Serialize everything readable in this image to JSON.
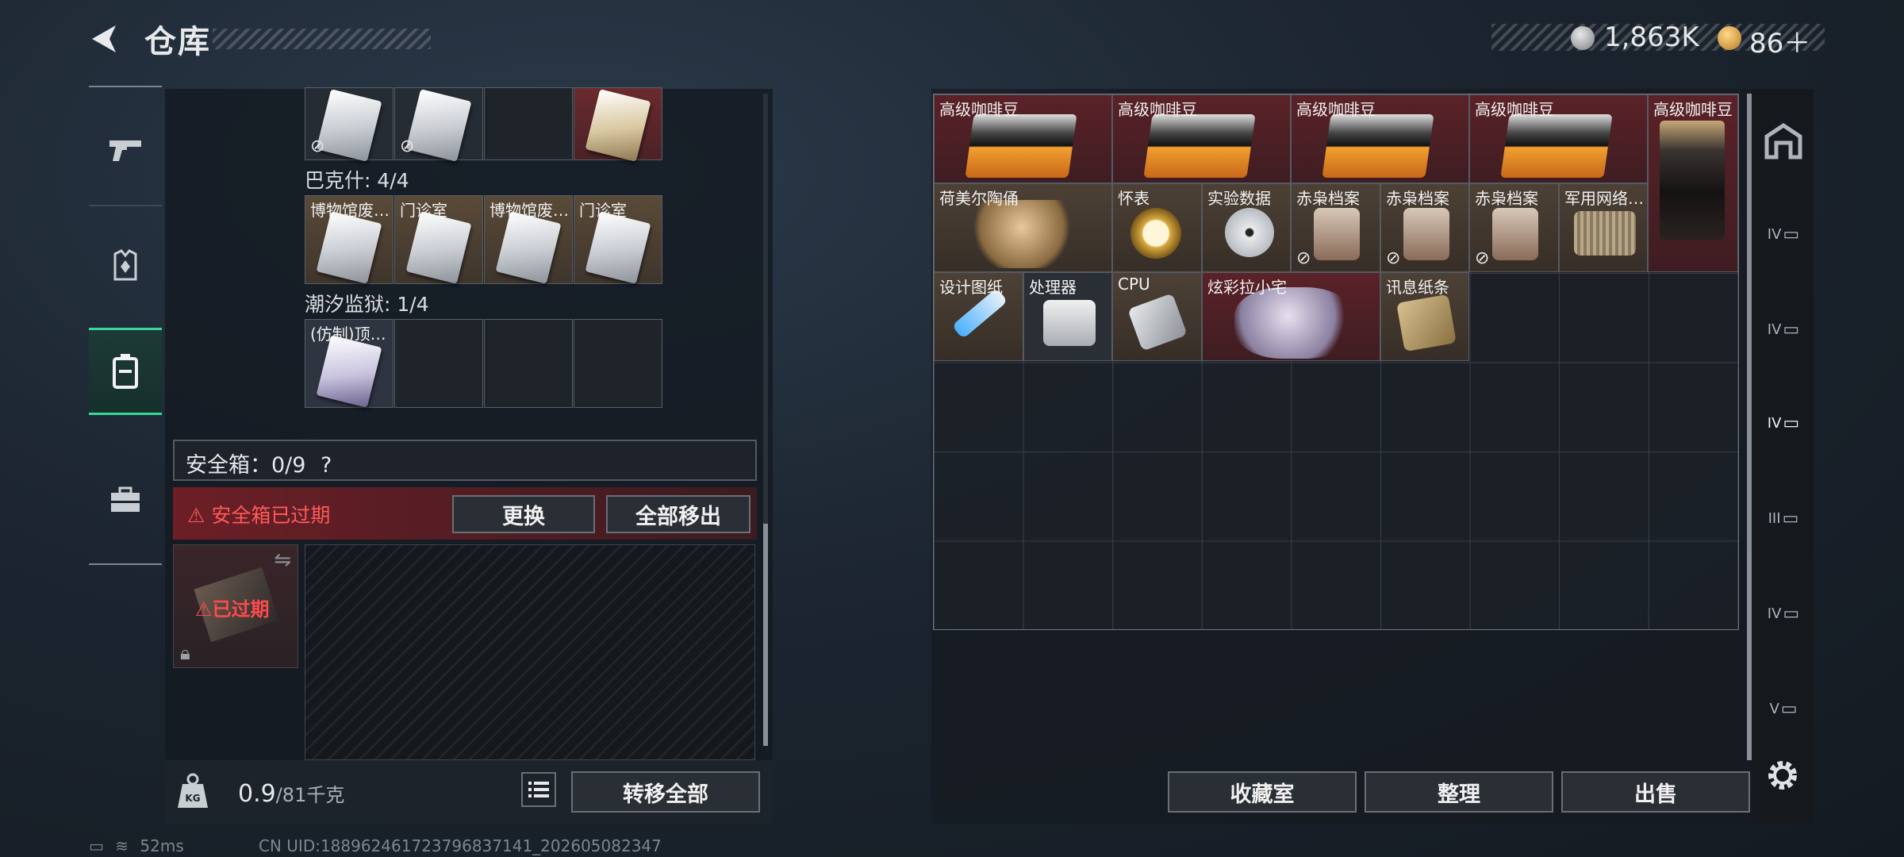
{
  "header": {
    "title": "仓库",
    "currency_silver": "1,863K",
    "currency_gold": "86＋"
  },
  "left": {
    "top_row_hidden": [
      "",
      "",
      "",
      ""
    ],
    "group1": {
      "label": "巴克什: 4/4",
      "items": [
        "博物馆废…",
        "门诊室",
        "博物馆废…",
        "门诊室"
      ]
    },
    "group2": {
      "label": "潮汐监狱: 1/4",
      "items": [
        "(仿制)顶…",
        "",
        "",
        ""
      ]
    },
    "safe_label": "安全箱：0/9",
    "safe_help": "?",
    "expired_text": "安全箱已过期",
    "replace_button": "更换",
    "move_all_button": "全部移出",
    "case_expired": "已过期",
    "weight_value": "0.9",
    "weight_max": "/81千克",
    "transfer_button": "转移全部"
  },
  "right": {
    "items": [
      {
        "name": "高级咖啡豆"
      },
      {
        "name": "高级咖啡豆"
      },
      {
        "name": "高级咖啡豆"
      },
      {
        "name": "高级咖啡豆"
      },
      {
        "name": "高级咖啡豆"
      },
      {
        "name": "荷美尔陶俑"
      },
      {
        "name": "怀表"
      },
      {
        "name": "实验数据"
      },
      {
        "name": "赤枭档案"
      },
      {
        "name": "赤枭档案"
      },
      {
        "name": "赤枭档案"
      },
      {
        "name": "军用网络…"
      },
      {
        "name": "设计图纸"
      },
      {
        "name": "处理器"
      },
      {
        "name": "CPU"
      },
      {
        "name": "炫彩拉小宅"
      },
      {
        "name": "讯息纸条"
      }
    ],
    "vault_button": "收藏室",
    "sort_button": "整理",
    "sell_button": "出售",
    "rail_slots": [
      "IV",
      "IV",
      "IV",
      "III",
      "IV",
      "V"
    ]
  },
  "status": {
    "ping": "52ms",
    "uid": "CN UID:188962461723796837141_202605082347"
  },
  "colors": {
    "accent": "#37d79a",
    "danger": "#ff5a5a"
  }
}
